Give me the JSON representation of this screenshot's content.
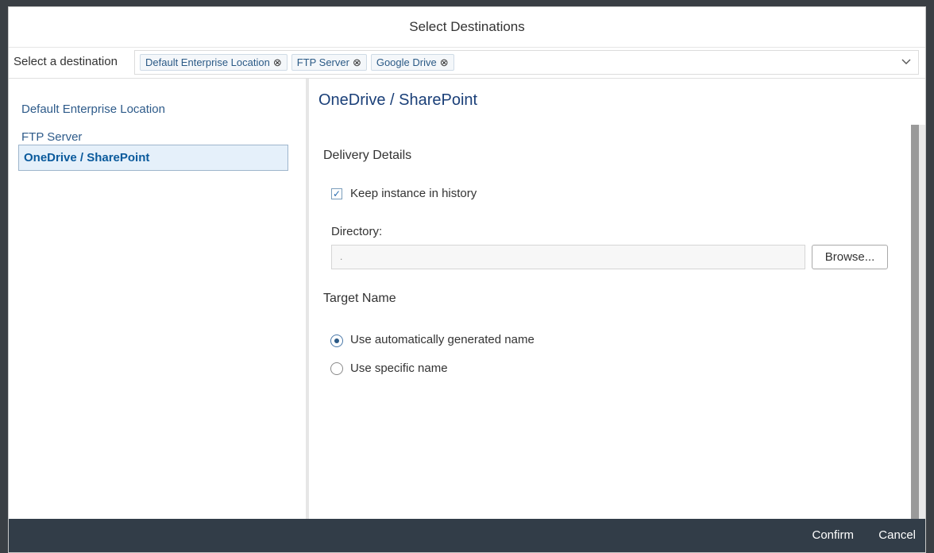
{
  "dialog": {
    "title": "Select Destinations"
  },
  "destination_bar": {
    "label": "Select a destination",
    "tokens": [
      {
        "label": "Default Enterprise Location",
        "remove": "⊗"
      },
      {
        "label": "FTP Server",
        "remove": "⊗"
      },
      {
        "label": "Google Drive",
        "remove": "⊗"
      }
    ]
  },
  "left_nav": {
    "items": [
      {
        "label": "Default Enterprise Location"
      },
      {
        "label": "FTP Server"
      },
      {
        "label": "OneDrive / SharePoint",
        "selected": true
      }
    ]
  },
  "detail": {
    "title": "OneDrive / SharePoint",
    "delivery_details": {
      "title": "Delivery Details",
      "keep_instance": {
        "label": "Keep instance in history",
        "checked": true,
        "check_glyph": "✓"
      },
      "directory": {
        "label": "Directory:",
        "value": ".",
        "browse_label": "Browse..."
      }
    },
    "target_name": {
      "title": "Target Name",
      "options": [
        {
          "label": "Use automatically generated name",
          "selected": true
        },
        {
          "label": "Use specific name",
          "selected": false
        }
      ]
    }
  },
  "footer": {
    "confirm_label": "Confirm",
    "cancel_label": "Cancel"
  },
  "colors": {
    "accent": "#0a5a9c",
    "footer_bg": "#323d48",
    "selected_bg": "#e5f0fa",
    "link": "#2e5b8a"
  }
}
